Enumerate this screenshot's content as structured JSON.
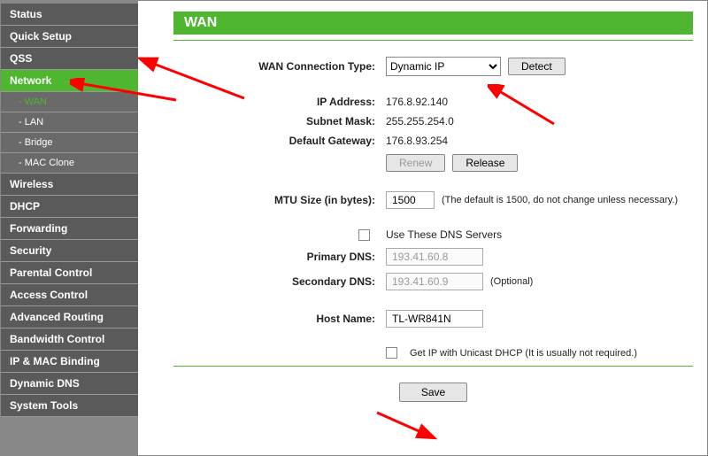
{
  "sidebar": {
    "items": [
      {
        "label": "Status",
        "kind": "top"
      },
      {
        "label": "Quick Setup",
        "kind": "top"
      },
      {
        "label": "QSS",
        "kind": "top"
      },
      {
        "label": "Network",
        "kind": "top",
        "active": true
      },
      {
        "label": "- WAN",
        "kind": "sub",
        "activeSub": true
      },
      {
        "label": "- LAN",
        "kind": "sub"
      },
      {
        "label": "- Bridge",
        "kind": "sub"
      },
      {
        "label": "- MAC Clone",
        "kind": "sub"
      },
      {
        "label": "Wireless",
        "kind": "top"
      },
      {
        "label": "DHCP",
        "kind": "top"
      },
      {
        "label": "Forwarding",
        "kind": "top"
      },
      {
        "label": "Security",
        "kind": "top"
      },
      {
        "label": "Parental Control",
        "kind": "top"
      },
      {
        "label": "Access Control",
        "kind": "top"
      },
      {
        "label": "Advanced Routing",
        "kind": "top"
      },
      {
        "label": "Bandwidth Control",
        "kind": "top"
      },
      {
        "label": "IP & MAC Binding",
        "kind": "top"
      },
      {
        "label": "Dynamic DNS",
        "kind": "top"
      },
      {
        "label": "System Tools",
        "kind": "top"
      }
    ]
  },
  "page": {
    "title": "WAN",
    "wanConnTypeLabel": "WAN Connection Type:",
    "wanConnTypeValue": "Dynamic IP",
    "detectBtn": "Detect",
    "ipAddressLabel": "IP Address:",
    "ipAddressValue": "176.8.92.140",
    "subnetMaskLabel": "Subnet Mask:",
    "subnetMaskValue": "255.255.254.0",
    "defaultGatewayLabel": "Default Gateway:",
    "defaultGatewayValue": "176.8.93.254",
    "renewBtn": "Renew",
    "releaseBtn": "Release",
    "mtuLabel": "MTU Size (in bytes):",
    "mtuValue": "1500",
    "mtuNote": "(The default is 1500, do not change unless necessary.)",
    "useDnsLabel": "Use These DNS Servers",
    "primaryDnsLabel": "Primary DNS:",
    "primaryDnsValue": "193.41.60.8",
    "secondaryDnsLabel": "Secondary DNS:",
    "secondaryDnsValue": "193.41.60.9",
    "optionalNote": "(Optional)",
    "hostNameLabel": "Host Name:",
    "hostNameValue": "TL-WR841N",
    "unicastLabel": "Get IP with Unicast DHCP (It is usually not required.)",
    "saveBtn": "Save"
  }
}
